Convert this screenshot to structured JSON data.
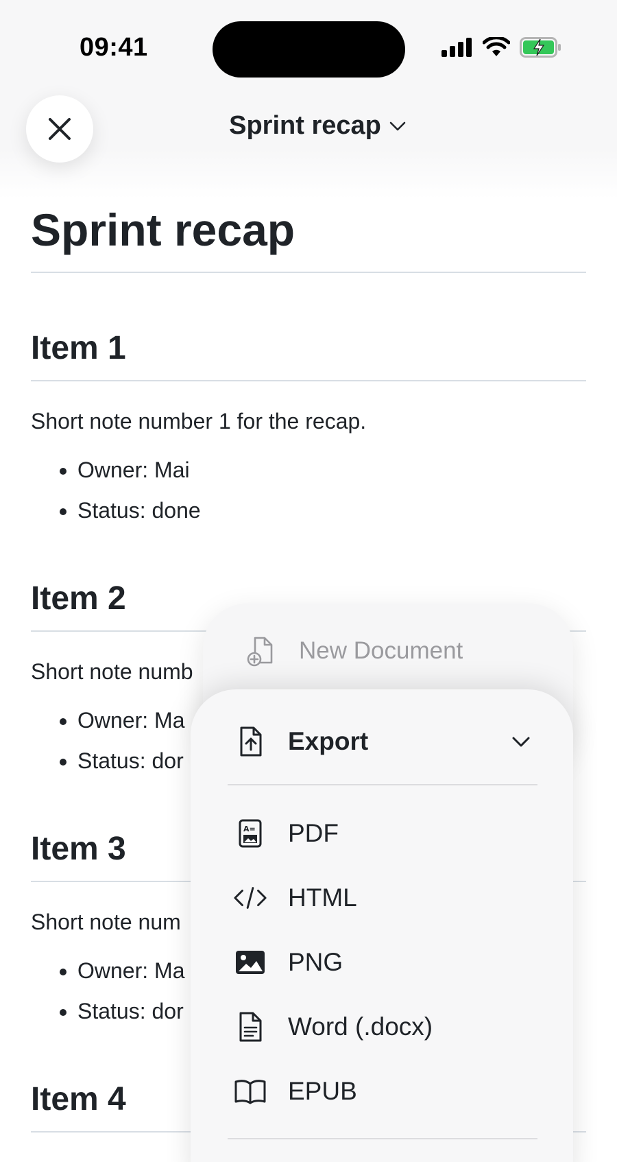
{
  "status_bar": {
    "time": "09:41",
    "battery_color": "#34c759"
  },
  "nav": {
    "title": "Sprint recap",
    "close_icon": "close-icon",
    "chevron_icon": "chevron-down-icon"
  },
  "document": {
    "title": "Sprint recap",
    "sections": [
      {
        "heading": "Item 1",
        "note": "Short note number 1 for the recap.",
        "bullets": [
          "Owner: Mai",
          "Status: done"
        ]
      },
      {
        "heading": "Item 2",
        "note": "Short note numb",
        "bullets": [
          "Owner: Ma",
          "Status: dor"
        ]
      },
      {
        "heading": "Item 3",
        "note": "Short note num",
        "bullets": [
          "Owner: Ma",
          "Status: dor"
        ]
      },
      {
        "heading": "Item 4"
      }
    ]
  },
  "menu": {
    "new_document": {
      "label": "New Document",
      "icon": "new-document-icon"
    },
    "export": {
      "label": "Export",
      "icon": "export-file-icon",
      "items": [
        {
          "label": "PDF",
          "icon": "pdf-icon"
        },
        {
          "label": "HTML",
          "icon": "code-icon"
        },
        {
          "label": "PNG",
          "icon": "image-icon"
        },
        {
          "label": "Word (.docx)",
          "icon": "document-icon"
        },
        {
          "label": "EPUB",
          "icon": "book-icon"
        }
      ]
    }
  }
}
